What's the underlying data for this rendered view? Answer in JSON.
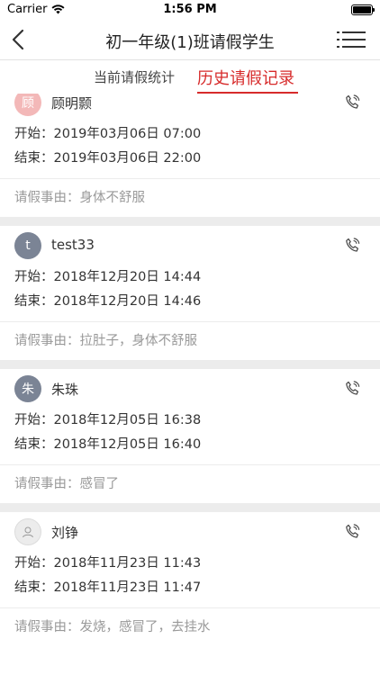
{
  "status_bar": {
    "carrier": "Carrier",
    "time": "1:56 PM"
  },
  "navbar": {
    "title": "初一年级(1)班请假学生"
  },
  "tabs": [
    {
      "label": "当前请假统计",
      "active": false
    },
    {
      "label": "历史请假记录",
      "active": true
    }
  ],
  "labels": {
    "start": "开始：",
    "end": "结束：",
    "reason": "请假事由："
  },
  "records": [
    {
      "avatar_char": "顾",
      "name": "顾明颢",
      "start": "2019年03月06日 07:00",
      "end": "2019年03月06日 22:00",
      "reason": "身体不舒服"
    },
    {
      "avatar_char": "t",
      "name": "test33",
      "start": "2018年12月20日 14:44",
      "end": "2018年12月20日 14:46",
      "reason": "拉肚子，身体不舒服"
    },
    {
      "avatar_char": "朱",
      "name": "朱珠",
      "start": "2018年12月05日 16:38",
      "end": "2018年12月05日 16:40",
      "reason": "感冒了"
    },
    {
      "avatar_char": "",
      "name": "刘铮",
      "start": "2018年11月23日 11:43",
      "end": "2018年11月23日 11:47",
      "reason": "发烧，感冒了，去挂水"
    }
  ],
  "colors": {
    "accent": "#d72b2b",
    "separator": "#ececec"
  }
}
